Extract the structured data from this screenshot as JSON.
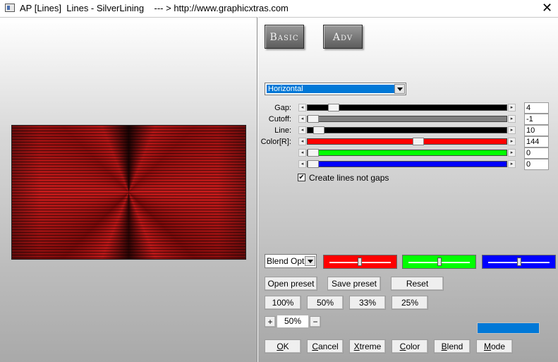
{
  "window": {
    "title": "AP [Lines]  Lines - SilverLining    --- > http://www.graphicxtras.com",
    "close_glyph": "✕"
  },
  "top_buttons": {
    "basic": "Basic",
    "adv": "Adv"
  },
  "direction_select": {
    "value": "Horizontal"
  },
  "sliders": {
    "gap": {
      "label": "Gap:",
      "value": "4",
      "track_color": "#000000",
      "level": 0.11
    },
    "cutoff": {
      "label": "Cutoff:",
      "value": "-1",
      "track_color": "#808080",
      "level": 0.0
    },
    "line": {
      "label": "Line:",
      "value": "10",
      "track_color": "#000000",
      "level": 0.03
    },
    "color_r": {
      "label": "Color[R]:",
      "value": "144",
      "track_color": "#ff0000",
      "level": 0.56
    },
    "color_g": {
      "label": "",
      "value": "0",
      "track_color": "#00ff00",
      "level": 0.0
    },
    "color_b": {
      "label": "",
      "value": "0",
      "track_color": "#0000ff",
      "level": 0.0
    }
  },
  "create_lines_checkbox": {
    "label": "Create lines not gaps",
    "checked": true,
    "mark": "✔"
  },
  "blend_select": {
    "value": "Blend Optio"
  },
  "channel_colors": {
    "red": "#ff0000",
    "green": "#00ff00",
    "blue": "#0000ff"
  },
  "preset_buttons": {
    "open": "Open preset",
    "save": "Save preset",
    "reset": "Reset"
  },
  "zoom_buttons": [
    "100%",
    "50%",
    "33%",
    "25%"
  ],
  "zoom_stepper": {
    "plus": "+",
    "value": "50%",
    "minus": "−"
  },
  "accent_color": "#0078d7",
  "bottom_buttons": {
    "ok": "OK",
    "cancel": "Cancel",
    "xtreme": "Xtreme",
    "color": "Color",
    "blend": "Blend",
    "mode": "Mode"
  }
}
